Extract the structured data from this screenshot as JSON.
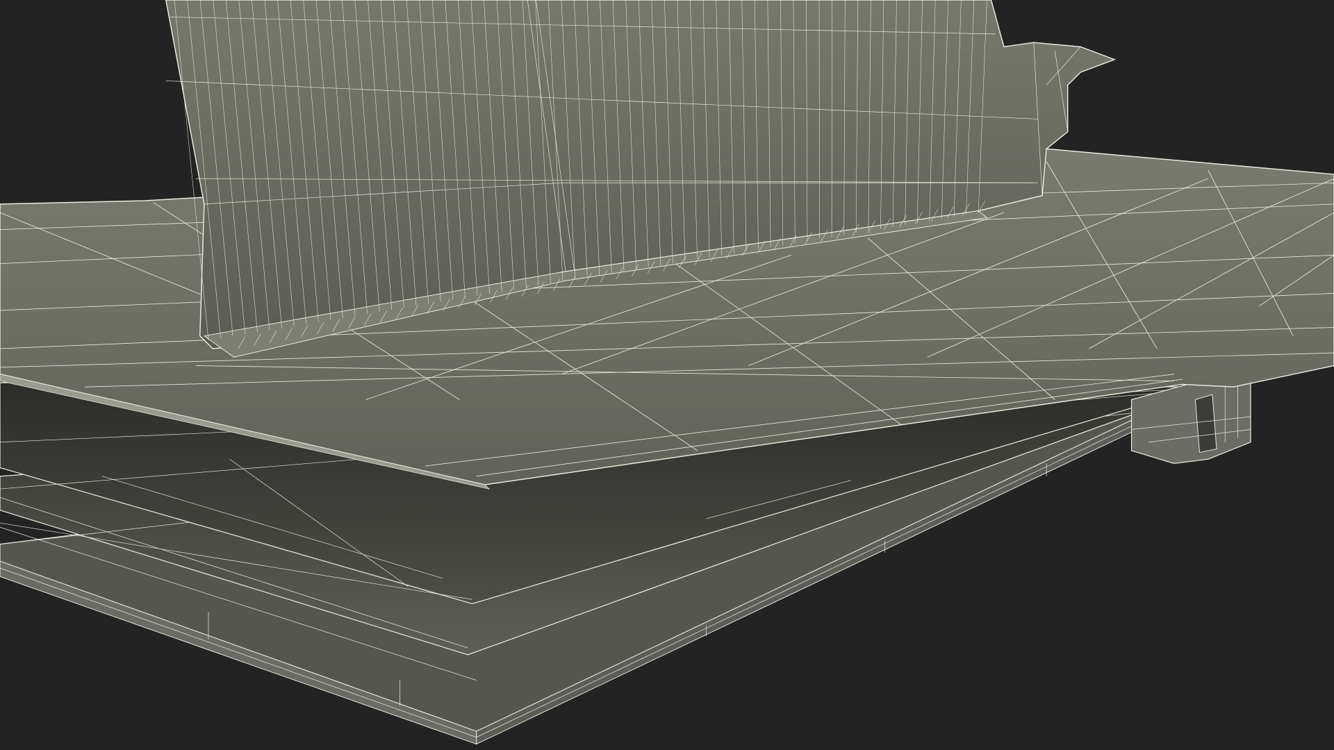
{
  "scene": {
    "subject": "wireframe-render-layered-panels-with-backrest",
    "background_color": "#232323",
    "surface_color": "#6d6e64",
    "surface_light_color": "#7b7c71",
    "surface_dark_color": "#3a3b36",
    "wire_color": "#e9e9dd"
  }
}
